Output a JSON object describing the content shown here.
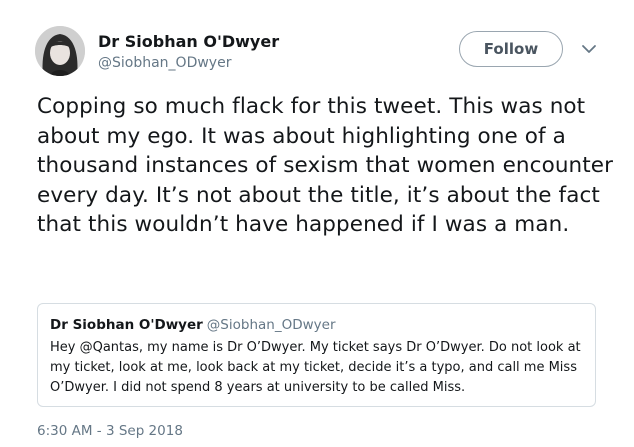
{
  "author": {
    "name": "Dr Siobhan O'Dwyer",
    "handle": "@Siobhan_ODwyer"
  },
  "follow_button": {
    "label": "Follow"
  },
  "more_icon": "chevron-down-icon",
  "tweet": {
    "text": "Copping so much flack for this tweet. This was not about my ego. It was about highlighting one of a thousand instances of sexism that women encounter every day. It’s not about the title, it’s about the fact that this wouldn’t have happened if I was a man.",
    "timestamp": "6:30 AM - 3 Sep 2018"
  },
  "quoted_tweet": {
    "author_name": "Dr Siobhan O'Dwyer",
    "author_handle": "@Siobhan_ODwyer",
    "text": "Hey @Qantas, my name is Dr O’Dwyer. My ticket says Dr O’Dwyer. Do not look at my ticket, look at me, look back at my ticket, decide it’s a typo, and call me Miss O’Dwyer. I did not spend 8 years at university to be called Miss."
  },
  "colors": {
    "text_primary": "#14171a",
    "text_secondary": "#657786",
    "border": "#d6dde2",
    "button_border": "#9aa6b0"
  }
}
